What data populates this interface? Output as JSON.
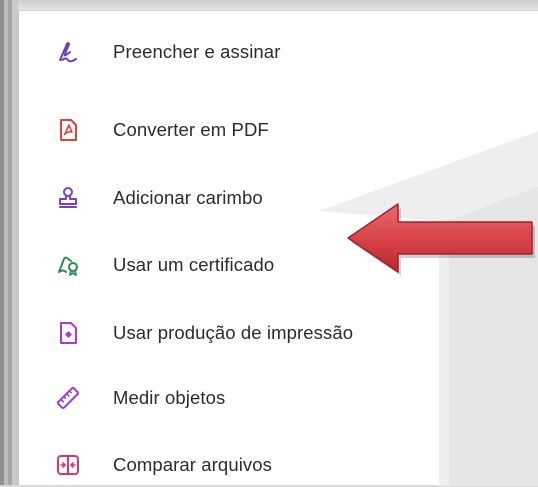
{
  "menu": {
    "items": [
      {
        "label": "Preencher e assinar",
        "icon": "fill-sign-icon",
        "color": "#6a3fb5"
      },
      {
        "label": "Converter em PDF",
        "icon": "convert-pdf-icon",
        "color": "#e0413b"
      },
      {
        "label": "Adicionar carimbo",
        "icon": "stamp-icon",
        "color": "#7b3fc4"
      },
      {
        "label": "Usar um certificado",
        "icon": "certificate-icon",
        "color": "#2f8a5b"
      },
      {
        "label": "Usar produção de impressão",
        "icon": "print-production-icon",
        "color": "#b13ac0"
      },
      {
        "label": "Medir objetos",
        "icon": "ruler-icon",
        "color": "#9a3fd0"
      },
      {
        "label": "Comparar arquivos",
        "icon": "compare-files-icon",
        "color": "#d9366b"
      }
    ]
  },
  "annotation": {
    "type": "callout-arrow",
    "color": "#d9444a",
    "points_to": "Usar um certificado"
  }
}
